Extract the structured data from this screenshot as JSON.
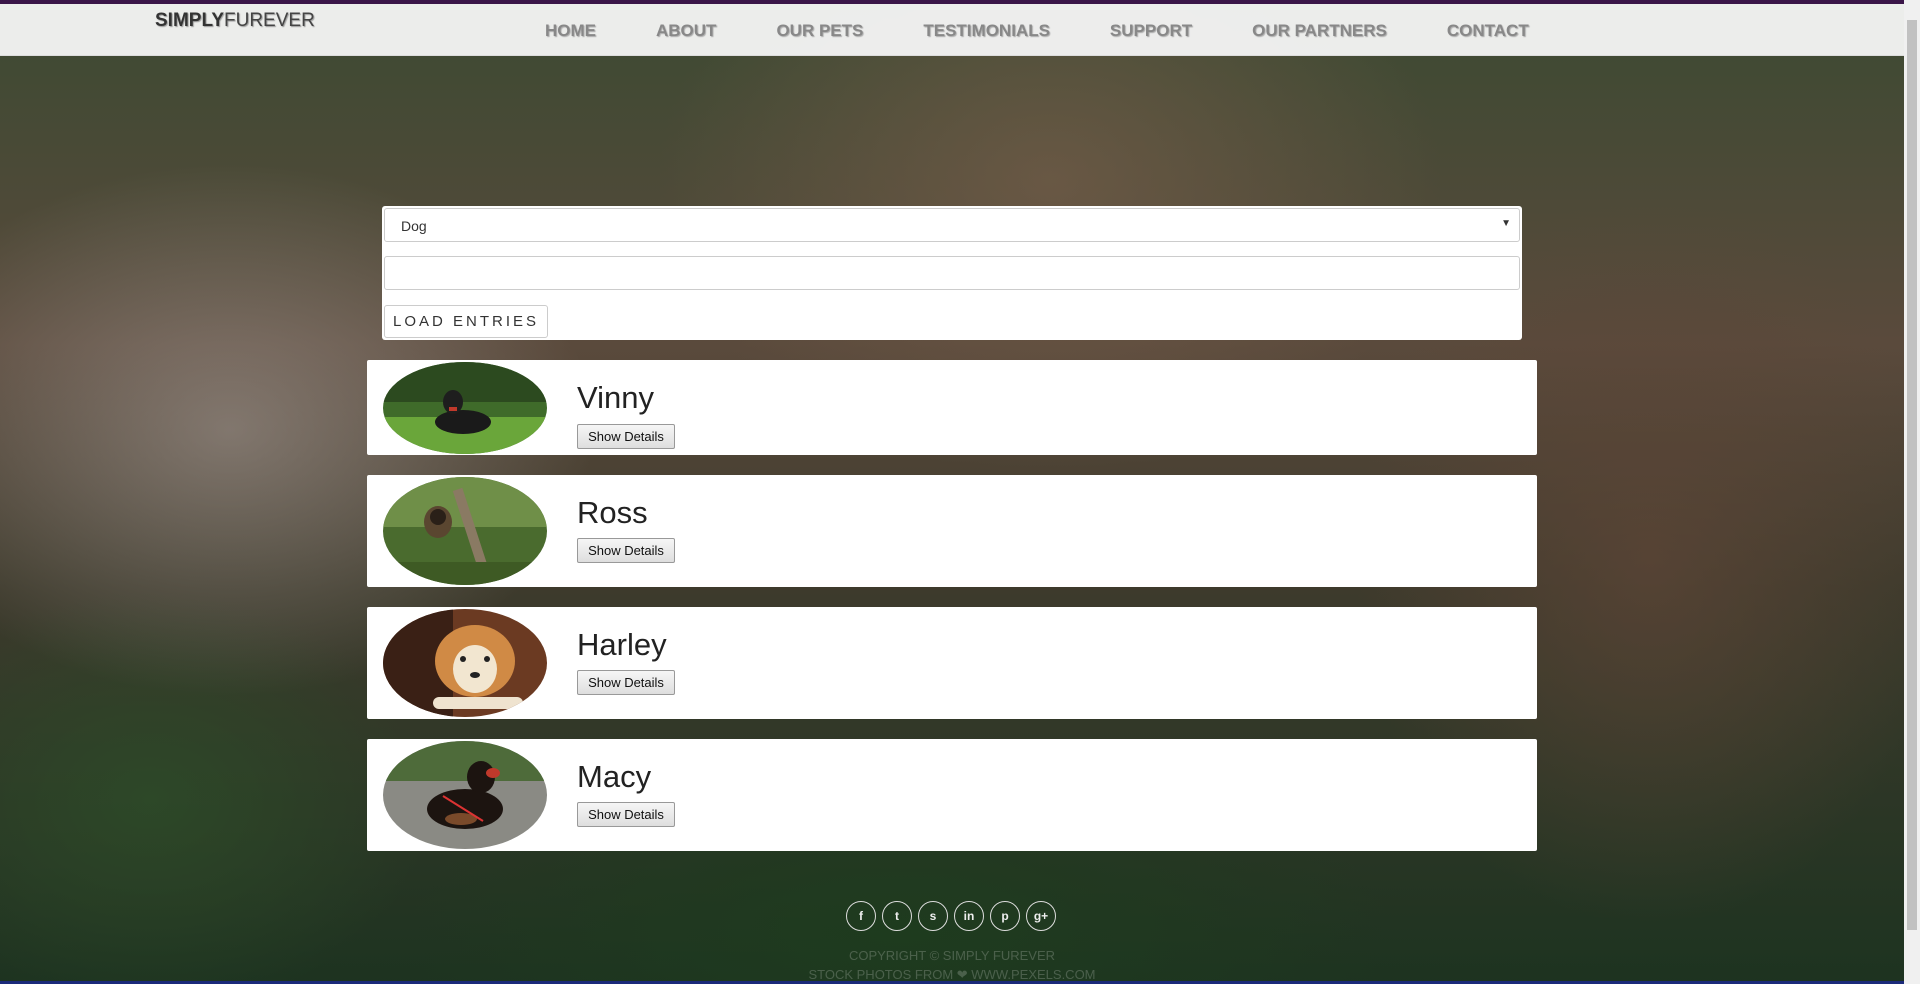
{
  "brand": {
    "bold": "SIMPLY",
    "rest": "FUREVER"
  },
  "nav": [
    "HOME",
    "ABOUT",
    "OUR PETS",
    "TESTIMONIALS",
    "SUPPORT",
    "OUR PARTNERS",
    "CONTACT"
  ],
  "filter": {
    "selected_type": "Dog",
    "search_value": "",
    "load_label": "LOAD ENTRIES"
  },
  "pets": [
    {
      "name": "Vinny",
      "button": "Show Details"
    },
    {
      "name": "Ross",
      "button": "Show Details"
    },
    {
      "name": "Harley",
      "button": "Show Details"
    },
    {
      "name": "Macy",
      "button": "Show Details"
    }
  ],
  "social_icons": [
    "facebook-icon",
    "twitter-icon",
    "skype-icon",
    "linkedin-icon",
    "pinterest-icon",
    "google-plus-icon"
  ],
  "footer": {
    "copyright": "COPYRIGHT © SIMPLY FUREVER",
    "credits": "STOCK PHOTOS FROM ❤ WWW.PEXELS.COM"
  },
  "colors": {
    "top_bar": "#3a1548",
    "nav_text": "#888888"
  }
}
